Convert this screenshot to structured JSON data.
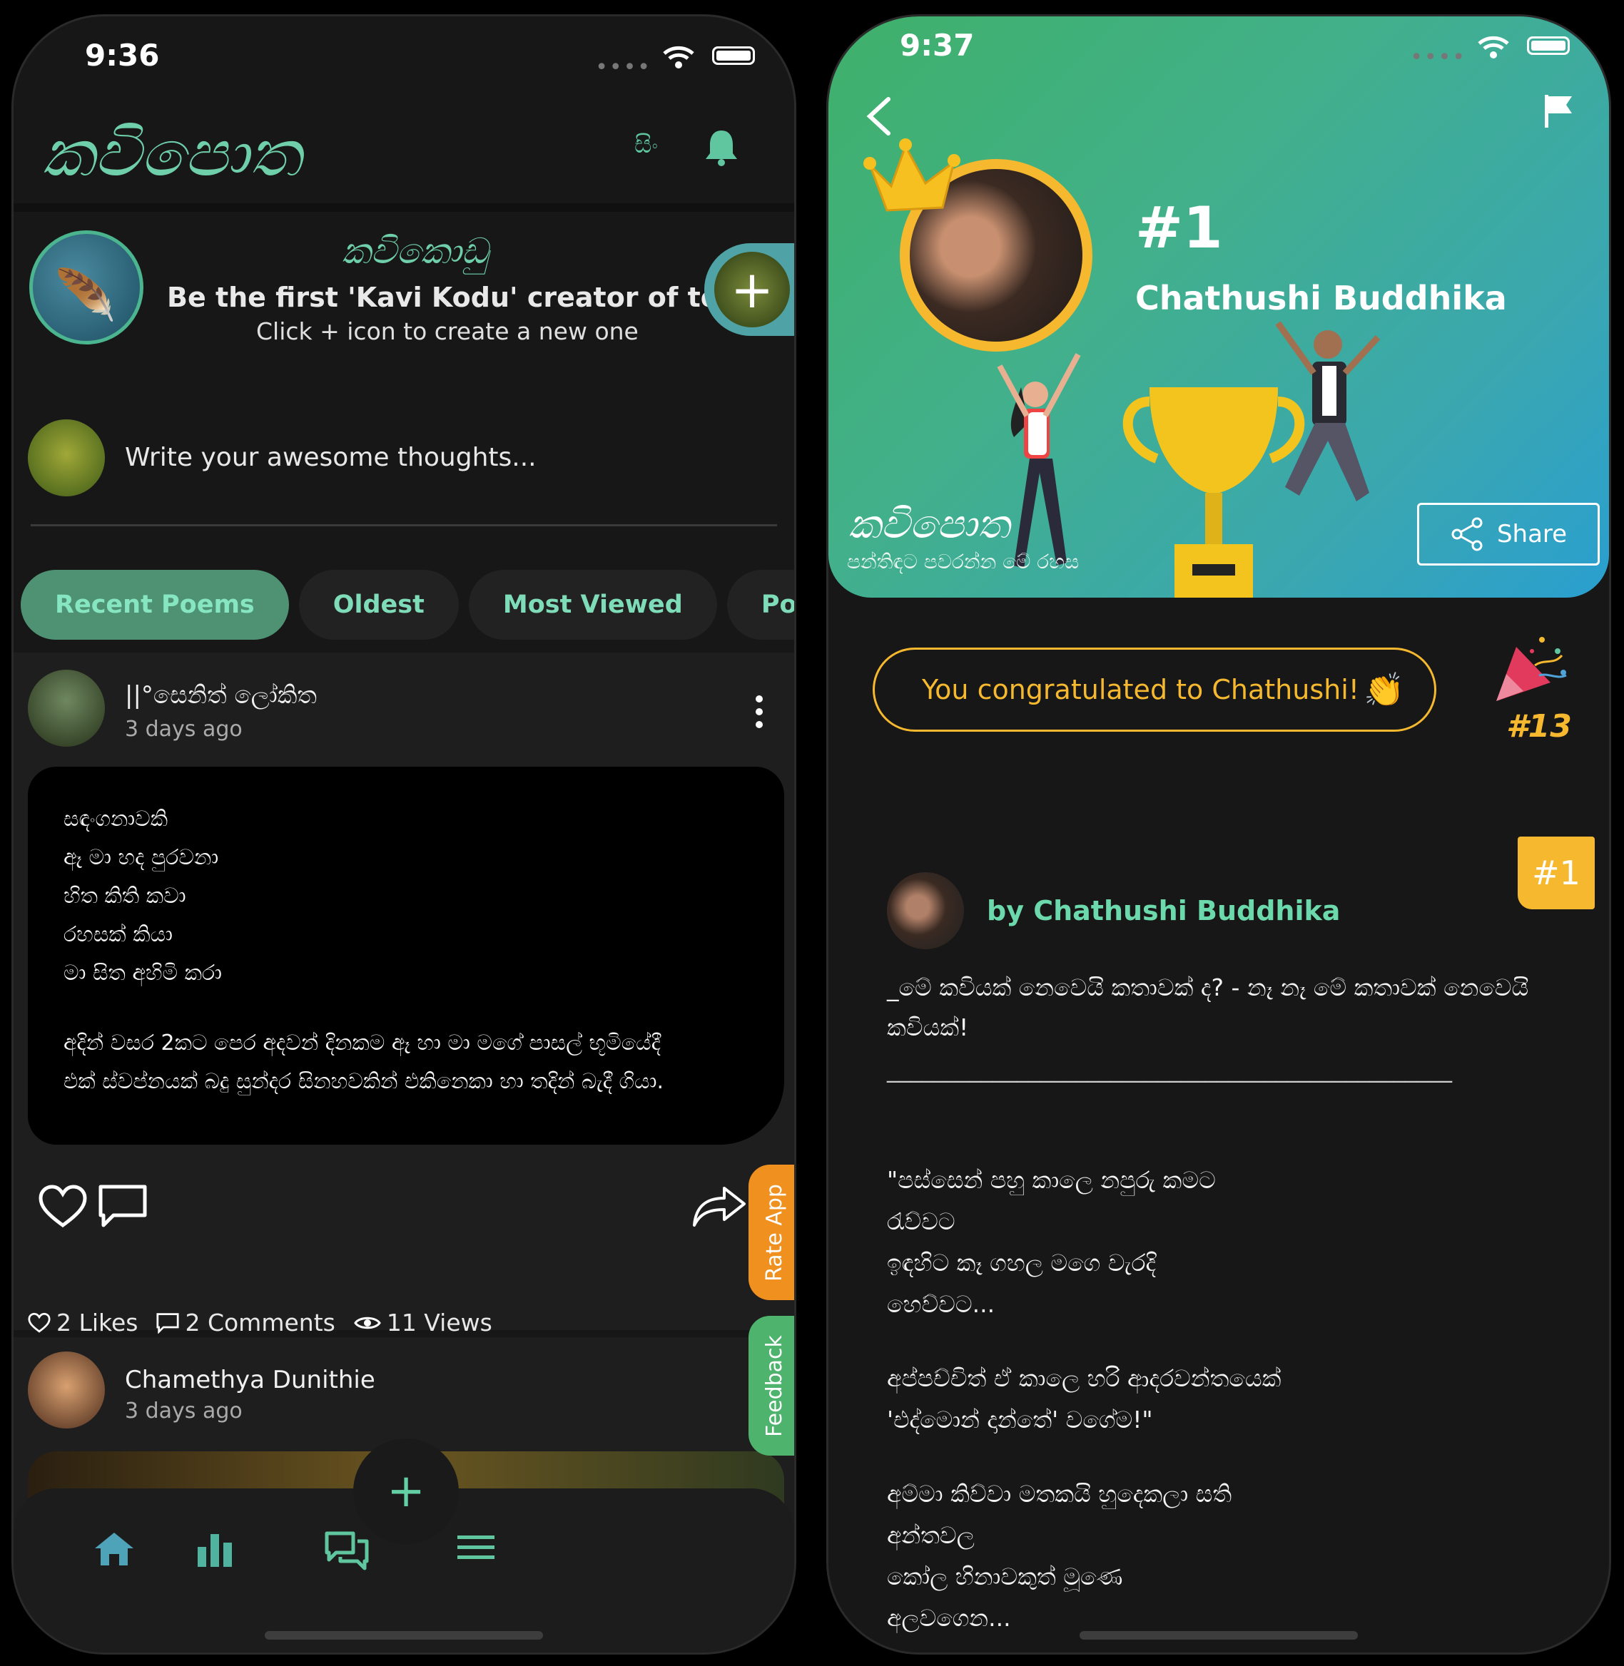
{
  "left": {
    "status_time": "9:36",
    "logo_text": "කවිපොත",
    "lang_label": "සිං",
    "kodu": {
      "logo_text": "කවිකොඩු",
      "title": "Be the first 'Kavi Kodu' creator of today",
      "subtitle": "Click + icon to create a new one"
    },
    "composer_placeholder": "Write your awesome thoughts...",
    "tabs": [
      "Recent Poems",
      "Oldest",
      "Most Viewed",
      "Poems of t"
    ],
    "post1": {
      "author": "||°සෙනිත් ලෝකිත",
      "time": "3 days ago",
      "lines": [
        "සඳංගනාවකි",
        "ඈ මා හද පුරවනා",
        "හිත කිති කවා",
        "රහසක් කියා",
        "මා සිත අහිමි කරා",
        "අදින් වසර 2කට පෙර අදවන් දිනකම ඈ හා මා මගේ පාසල් භූමියේදී",
        "එක් ස්වප්නයක් බදු සුන්දර සිනහවකින් එකිනෙකා හා තදින් බැදී ගියා."
      ],
      "likes": "2 Likes",
      "comments": "2 Comments",
      "views": "11 Views"
    },
    "post2": {
      "author": "Chamethya Dunithie",
      "time": "3 days ago"
    },
    "side_tabs": {
      "rate": "Rate App",
      "feedback": "Feedback"
    }
  },
  "right": {
    "status_time": "9:37",
    "rank_big": "#1",
    "winner_name": "Chathushi Buddhika",
    "banner_logo": "කවිපොත",
    "banner_tagline": "පන්තිඳට පවරන්න මේ රහස",
    "share_label": "Share",
    "congrats_text": "You congratulated to Chathushi!",
    "rank_small": "#13",
    "rank_badge": "#1",
    "author": "by Chathushi Buddhika",
    "poem_lines": [
      "_මේ කවියක් නෙවෙයි කතාවක් ද? - නෑ නෑ මේ කතාවක් නෙවෙයි",
      "කවියක්!",
      "________________________________________________",
      "\"පස්සෙන් පහු කාලෙ නපුරු කමට",
      "රැව්වට",
      "ඉඳහිට කෑ ගහල මගෙ වැරදි",
      "හෙව්වට...",
      "අප්පච්චිත් ඒ කාලෙ හරි ආදරවන්තයෙක්",
      "'එද්මොන් දාන්තේ' වගේම!\"",
      "අම්මා කිව්වා මතකයි හුදෙකලා සති",
      "අන්තවල",
      "කෝල හිනාවකුත් මූණෙ",
      "අලවගෙන..."
    ]
  },
  "colors": {
    "accent": "#63cfa5",
    "gold": "#f5b82e",
    "bg": "#171717"
  }
}
